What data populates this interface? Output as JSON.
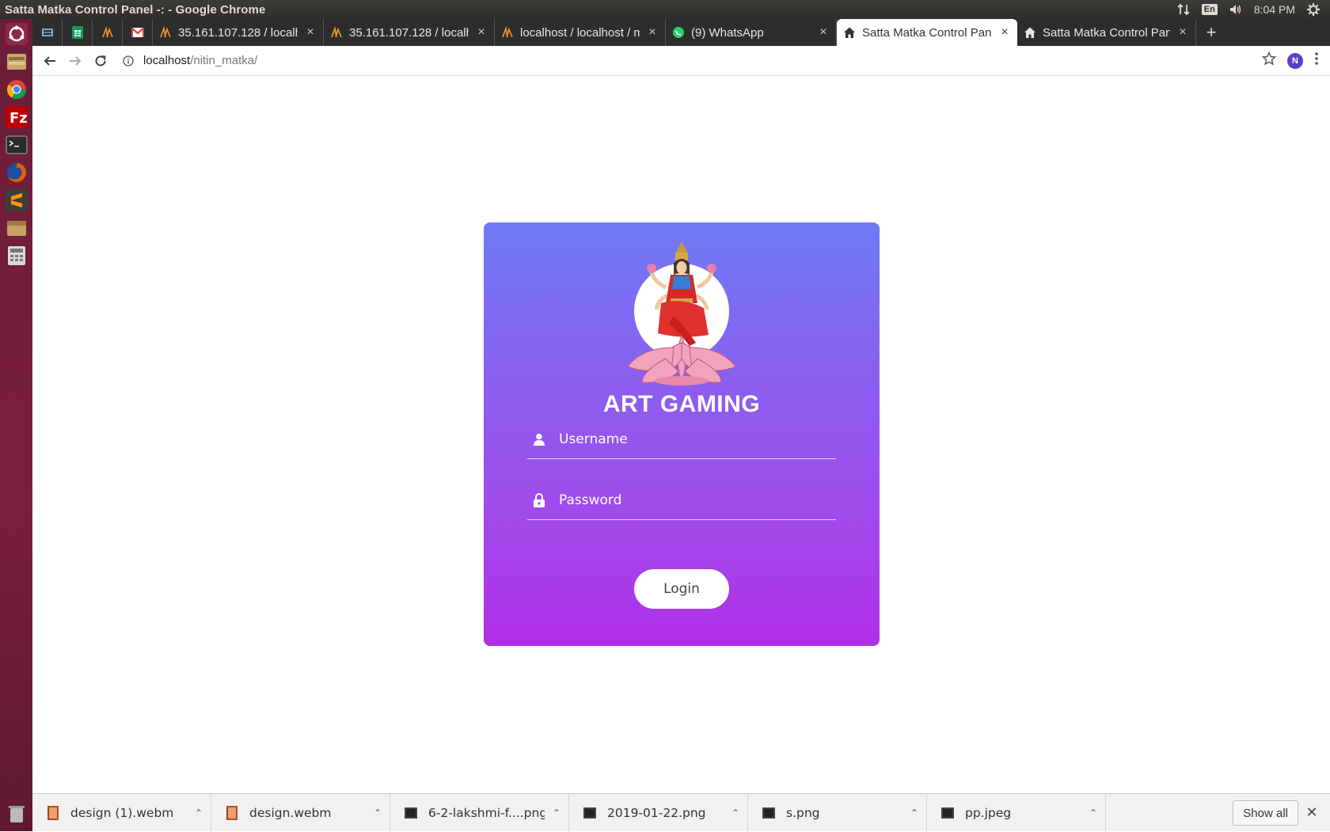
{
  "system": {
    "window_title": "Satta Matka Control Panel -: - Google Chrome",
    "lang": "En",
    "time": "8:04 PM"
  },
  "tabs": [
    {
      "icon": "drive-icon",
      "pinned": true
    },
    {
      "icon": "sheets-icon",
      "pinned": true
    },
    {
      "icon": "phpmyadmin-icon",
      "pinned": true
    },
    {
      "icon": "gmail-icon",
      "pinned": true
    },
    {
      "title": "35.161.107.128 / localho",
      "icon": "phpmyadmin-icon"
    },
    {
      "title": "35.161.107.128 / localho",
      "icon": "phpmyadmin-icon"
    },
    {
      "title": "localhost / localhost / m",
      "icon": "phpmyadmin-icon"
    },
    {
      "title": "(9) WhatsApp",
      "icon": "whatsapp-icon"
    },
    {
      "title": "Satta Matka Control Pan",
      "icon": "home-icon",
      "active": true
    },
    {
      "title": "Satta Matka Control Pan",
      "icon": "home-icon"
    }
  ],
  "address": {
    "host": "localhost",
    "path": "/nitin_matka/"
  },
  "login": {
    "brand": "ART GAMING",
    "username_placeholder": "Username",
    "password_placeholder": "Password",
    "button_label": "Login"
  },
  "downloads": [
    {
      "name": "design (1).webm",
      "icon": "video-file-icon"
    },
    {
      "name": "design.webm",
      "icon": "video-file-icon"
    },
    {
      "name": "6-2-lakshmi-f....png",
      "icon": "image-file-icon"
    },
    {
      "name": "2019-01-22.png",
      "icon": "image-file-icon"
    },
    {
      "name": "s.png",
      "icon": "image-file-icon"
    },
    {
      "name": "pp.jpeg",
      "icon": "image-file-icon"
    }
  ],
  "download_bar": {
    "show_all": "Show all"
  },
  "colors": {
    "card_top": "#6d7bf4",
    "card_bottom": "#b02ee6",
    "launcher": "#7a1f3d"
  }
}
